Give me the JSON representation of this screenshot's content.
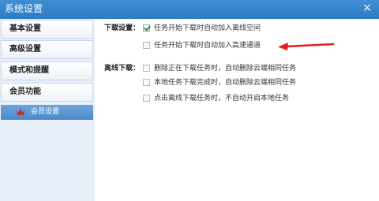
{
  "window": {
    "title": "系统设置",
    "close_glyph": "×"
  },
  "sidebar": {
    "items": [
      {
        "label": "基本设置"
      },
      {
        "label": "高级设置"
      },
      {
        "label": "模式和提醒"
      },
      {
        "label": "会员功能"
      }
    ],
    "sub_items": [
      {
        "label": "会员设置",
        "icon": "crown-icon"
      }
    ]
  },
  "download_section": {
    "label": "下载设置：",
    "options": [
      {
        "label": "任务开始下载时自动加入离线空间",
        "checked": true
      },
      {
        "label": "任务开始下载时自动加入高速通道",
        "checked": false
      }
    ]
  },
  "offline_section": {
    "label": "离线下载：",
    "options": [
      {
        "label": "删除正在下载任务时，自动删除云端相同任务",
        "checked": false
      },
      {
        "label": "本地任务下载完成时，自动删除云端相同任务",
        "checked": false
      },
      {
        "label": "点击离线下载任务时，不自动开启本地任务",
        "checked": false
      }
    ]
  },
  "colors": {
    "accent": "#2f7cc4",
    "annotation": "#e02020",
    "check": "#3a8a3a"
  }
}
